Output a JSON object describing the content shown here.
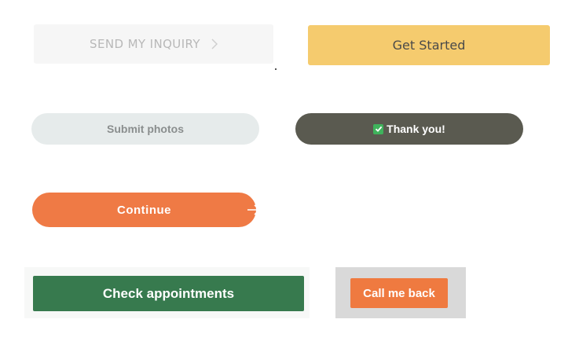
{
  "buttons": {
    "send_inquiry": {
      "label": "SEND MY INQUIRY",
      "state": "disabled",
      "icon": "chevron-right-icon"
    },
    "get_started": {
      "label": "Get Started"
    },
    "submit_photos": {
      "label": "Submit photos",
      "state": "disabled"
    },
    "thank_you": {
      "label": "Thank you!",
      "icon": "check-mark-icon"
    },
    "continue": {
      "label": "Continue",
      "icon": "arrow-right-icon"
    },
    "check_appointments": {
      "label": "Check appointments"
    },
    "call_me_back": {
      "label": "Call me back"
    }
  },
  "colors": {
    "disabled_bg": "#f6f6f6",
    "yellow": "#f5cb6e",
    "light_gray": "#e6ebeb",
    "dark_olive": "#5a5a50",
    "orange": "#ef7a45",
    "green": "#377a4e",
    "check_green": "#3fb35c"
  }
}
